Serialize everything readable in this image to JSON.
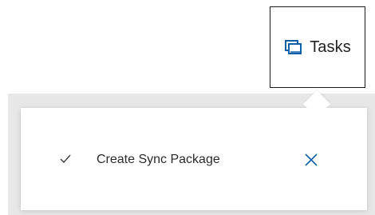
{
  "header": {
    "tasks_label": "Tasks",
    "tasks_icon": "tasks-stack-icon"
  },
  "flyout": {
    "tasks": [
      {
        "status_icon": "check-icon",
        "label": "Create Sync Package",
        "dismiss_icon": "close-icon"
      }
    ]
  },
  "colors": {
    "accent": "#0f5fa8",
    "text": "#2b2b2b",
    "backdrop": "#e7e7e7"
  }
}
